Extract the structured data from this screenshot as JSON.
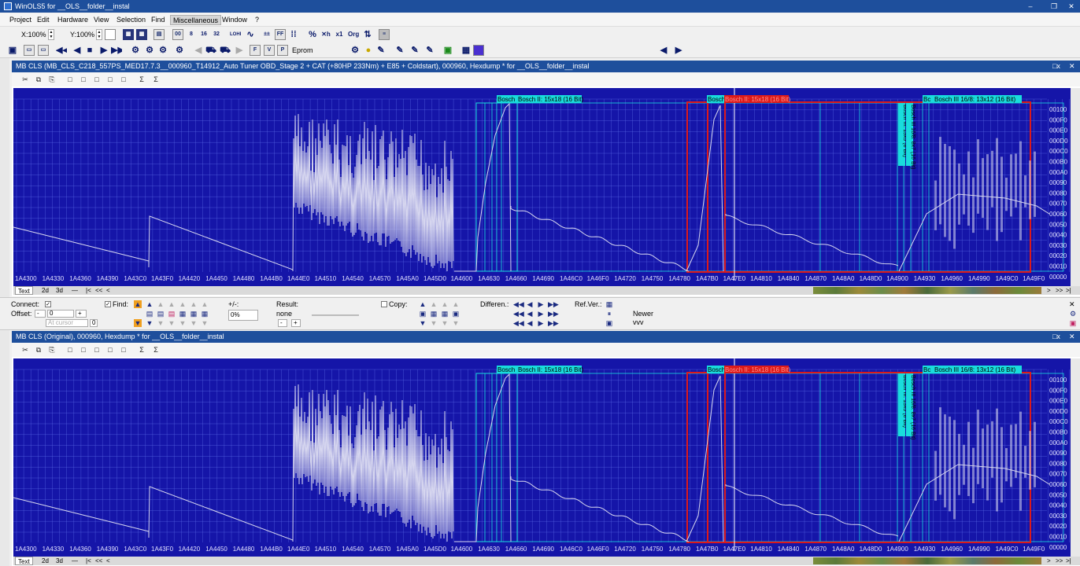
{
  "app": {
    "title": "WinOLS5 for __OLS__folder__instal",
    "controls": [
      "–",
      "❐",
      "✕"
    ]
  },
  "menu": [
    "Project",
    "Edit",
    "Hardware",
    "View",
    "Selection",
    "Find",
    "Miscellaneous",
    "Window",
    "?"
  ],
  "toolbar": {
    "x_zoom": "X:100%",
    "y_zoom": "Y:100%",
    "eprom_label": "Eprom"
  },
  "windows": [
    {
      "title": "MB CLS (MB_CLS_C218_557PS_MED17.7.3__000960_T14912_Auto Tuner OBD_Stage 2 + CAT (+80HP 233Nm) + E85 + Coldstart), 000960, Hexdump * for __OLS__folder__instal",
      "controls": [
        "□x",
        "✕"
      ]
    },
    {
      "title": "MB CLS (Original), 000960, Hexdump * for __OLS__folder__instal",
      "controls": [
        "□x",
        "✕"
      ]
    }
  ],
  "window_toolbar": [
    "✂",
    "⧉",
    "⎘",
    "□",
    "□",
    "□",
    "□",
    "□",
    "Σ",
    "Σ"
  ],
  "x_labels": [
    "1A4300",
    "1A4330",
    "1A4360",
    "1A4390",
    "1A43C0",
    "1A43F0",
    "1A4420",
    "1A4450",
    "1A4480",
    "1A44B0",
    "1A44E0",
    "1A4510",
    "1A4540",
    "1A4570",
    "1A45A0",
    "1A45D0",
    "1A4600",
    "1A4630",
    "1A4660",
    "1A4690",
    "1A46C0",
    "1A46F0",
    "1A4720",
    "1A4750",
    "1A4780",
    "1A47B0",
    "1A47E0",
    "1A4810",
    "1A4840",
    "1A4870",
    "1A48A0",
    "1A48D0",
    "1A4900",
    "1A4930",
    "1A4960",
    "1A4990",
    "1A49C0",
    "1A49F0"
  ],
  "y_labels": [
    "00100",
    "000F0",
    "000E0",
    "000D0",
    "000C0",
    "000B0",
    "000A0",
    "00090",
    "00080",
    "00070",
    "00060",
    "00050",
    "00040",
    "00030",
    "00020",
    "00010",
    "00000"
  ],
  "map_labels": {
    "bosch_a": "Bosch",
    "bosch_a_full": "Bosch II: 15x18 (16 Bit)",
    "bosch_b": "Bosch",
    "bosch_b_full": "Bosch II: 15x18 (16 Bit)",
    "bosch_c": "Bc",
    "bosch_c_full": "Bosch III 16/8: 13x12 (16 Bit)",
    "vert_1": "Bosch III: 13x5 (8 Bit)",
    "vert_2": "Bosch III 16/8: 8x7 (16 Bit)"
  },
  "bottom_tabs": [
    "Text",
    "2d",
    "3d",
    "—",
    "|<",
    "<<",
    "<"
  ],
  "bottom_nav": [
    ">",
    ">>",
    ">|"
  ],
  "find_panel": {
    "connect": "Connect:",
    "offset": "Offset:",
    "offset_value": "0",
    "offset_value2": "0",
    "at_cursor": "At cursor",
    "find": "Find:",
    "plusminus": "+/-:",
    "percent": "0%",
    "result": "Result:",
    "result_value": "none",
    "copy": "Copy:",
    "differences": "Differen.:",
    "ref_ver": "Ref.Ver.:",
    "newer": "Newer",
    "vvv": "vvv",
    "minus": "-",
    "plus": "+",
    "close": "✕"
  },
  "colors": {
    "plot_bg": "#1515a8",
    "grid": "#5c6de8",
    "curve": "#d6d6ef",
    "cyan": "#19dcdc",
    "red": "#dd1a1a",
    "titlebar": "#1e4f9c"
  }
}
